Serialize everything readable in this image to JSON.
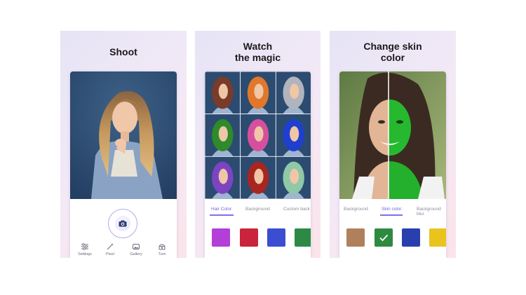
{
  "panels": [
    {
      "title_line1": "Shoot",
      "title_line2": ""
    },
    {
      "title_line1": "Watch",
      "title_line2": "the magic"
    },
    {
      "title_line1": "Change skin",
      "title_line2": "color"
    }
  ],
  "shoot_screen": {
    "bottom_bar": [
      {
        "label": "Settings",
        "icon": "sliders-icon"
      },
      {
        "label": "Pixel",
        "icon": "magic-wand-icon"
      },
      {
        "label": "Gallery",
        "icon": "gallery-icon"
      },
      {
        "label": "Turn",
        "icon": "rotate-camera-icon"
      }
    ],
    "shutter_icon": "camera-icon"
  },
  "hair_screen": {
    "tabs": [
      "Hair Color",
      "Background",
      "Custom back"
    ],
    "active_tab": 0,
    "hair_grid_colors": [
      "#7a3b2a",
      "#e0772b",
      "#b0b4be",
      "#2e8a2a",
      "#d64f9e",
      "#1e3fd0",
      "#7d44c2",
      "#a8261f",
      "#8fc9a7"
    ],
    "swatches": [
      "#b33ed8",
      "#c9243c",
      "#3b4ed1",
      "#2d8a45"
    ]
  },
  "skin_screen": {
    "tabs": [
      "Background",
      "Skin color",
      "Background blur"
    ],
    "active_tab": 1,
    "swatches": [
      "#b0805d",
      "#2e8a40",
      "#2a3fae",
      "#e9c41f"
    ],
    "selected_swatch": 1
  }
}
